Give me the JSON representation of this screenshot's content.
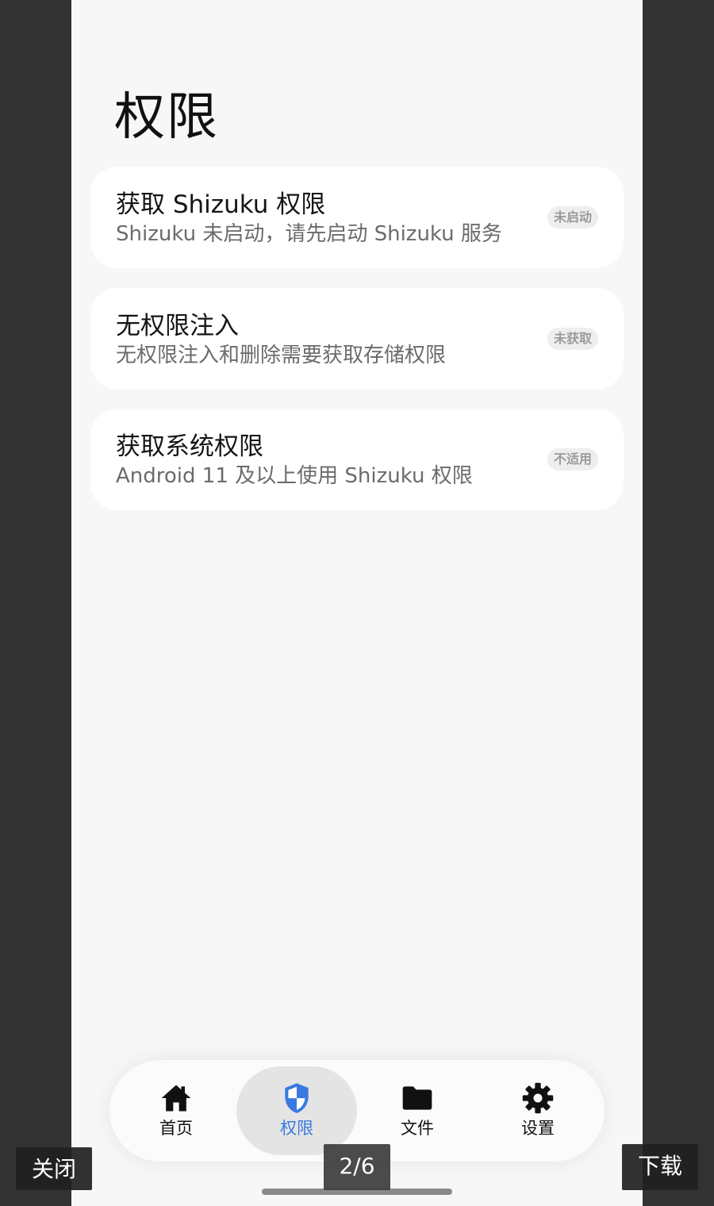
{
  "page": {
    "title": "权限"
  },
  "cards": [
    {
      "title": "获取 Shizuku 权限",
      "subtitle": "Shizuku 未启动，请先启动 Shizuku 服务",
      "status": "未启动"
    },
    {
      "title": "无权限注入",
      "subtitle": "无权限注入和删除需要获取存储权限",
      "status": "未获取"
    },
    {
      "title": "获取系统权限",
      "subtitle": "Android 11 及以上使用 Shizuku 权限",
      "status": "不适用"
    }
  ],
  "nav": {
    "items": [
      {
        "label": "首页",
        "icon": "home-icon"
      },
      {
        "label": "权限",
        "icon": "shield-icon",
        "active": true
      },
      {
        "label": "文件",
        "icon": "folder-icon"
      },
      {
        "label": "设置",
        "icon": "gear-icon"
      }
    ]
  },
  "viewer": {
    "close_label": "关闭",
    "page_indicator": "2/6",
    "download_label": "下载"
  },
  "colors": {
    "accent": "#3a7ae0",
    "background": "#f7f7f7",
    "card": "#ffffff",
    "viewer_background": "#333333"
  }
}
